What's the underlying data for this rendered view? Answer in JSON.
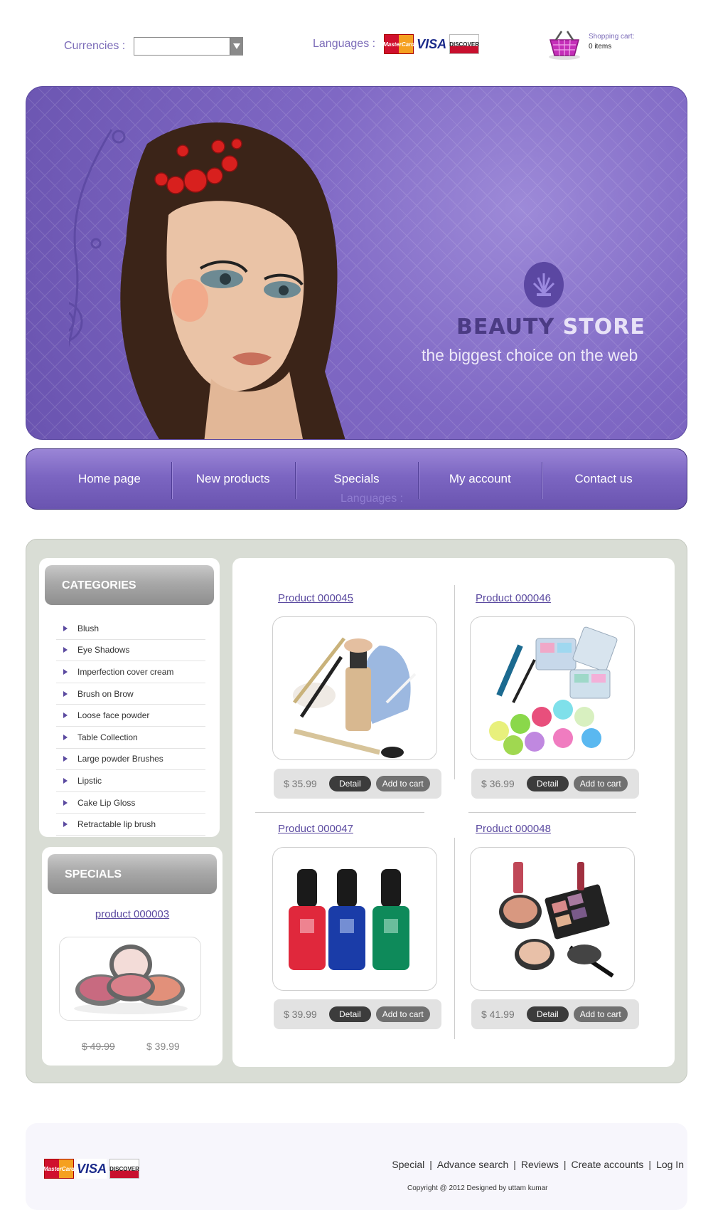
{
  "header": {
    "currencies_label": "Currencies :",
    "currency_value": "",
    "languages_label": "Languages :",
    "payment_cards": [
      "MasterCard",
      "VISA",
      "DISCOVER"
    ],
    "cart_title": "Shopping cart:",
    "cart_items": "0 items"
  },
  "banner": {
    "title_part1": "BEAUTY",
    "title_part2": "STORE",
    "tagline": "the biggest choice on the web"
  },
  "nav": {
    "items": [
      "Home page",
      "New products",
      "Specials",
      "My account",
      "Contact us"
    ],
    "ghost_label": "Languages :"
  },
  "sidebar": {
    "categories_title": "CATEGORIES",
    "categories": [
      "Blush",
      "Eye Shadows",
      "Imperfection cover cream",
      "Brush on Brow",
      "Loose face powder",
      "Table Collection",
      "Large powder Brushes",
      "Lipstic",
      "Cake Lip Gloss",
      "Retractable lip brush"
    ],
    "specials_title": "SPECIALS",
    "special": {
      "name": "product  000003",
      "old_price": "$ 49.99",
      "new_price": "$ 39.99"
    }
  },
  "products": [
    {
      "name": "Product 000045",
      "price": "$ 35.99",
      "detail": "Detail",
      "add": "Add to cart",
      "image": "makeup-brushes-foundation"
    },
    {
      "name": "Product 000046",
      "price": "$ 36.99",
      "detail": "Detail",
      "add": "Add to cart",
      "image": "eyeshadow-palette-mascara"
    },
    {
      "name": "Product 000047",
      "price": "$ 39.99",
      "detail": "Detail",
      "add": "Add to cart",
      "image": "nail-polish-bottles"
    },
    {
      "name": "Product 000048",
      "price": "$ 41.99",
      "detail": "Detail",
      "add": "Add to cart",
      "image": "makeup-kit"
    }
  ],
  "footer": {
    "links": [
      "Special",
      "Advance search",
      "Reviews",
      "Create accounts",
      "Log In"
    ],
    "separator": "|",
    "copyright": "Copyright @ 2012 Designed by uttam kumar"
  },
  "colors": {
    "brand_purple": "#7b66c2",
    "link_purple": "#5b4aa0",
    "panel_gray": "#d9ddd5"
  }
}
